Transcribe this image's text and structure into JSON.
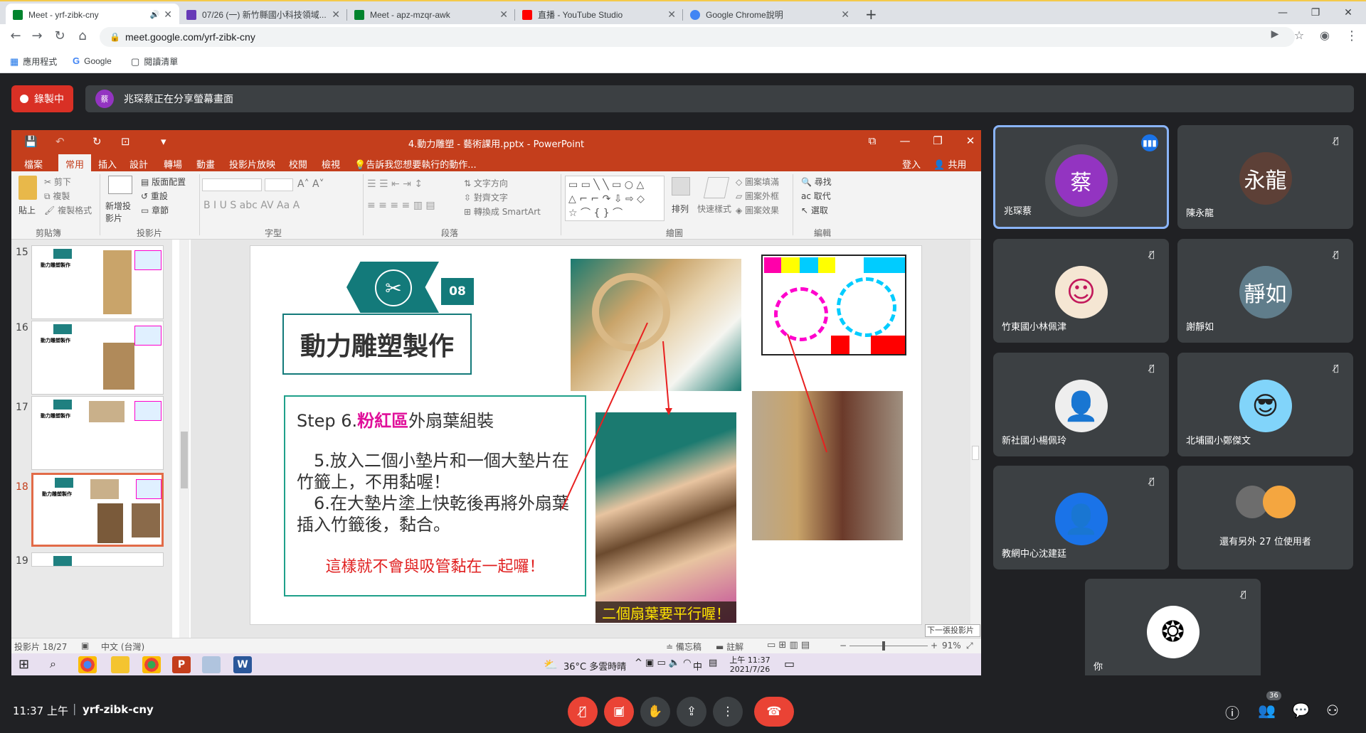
{
  "browser": {
    "tabs": [
      {
        "title": "Meet - yrf-zibk-cny",
        "icon_color": "#00832d"
      },
      {
        "title": "07/26 (一) 新竹縣國小科技領域...",
        "icon_color": "#673ab7"
      },
      {
        "title": "Meet - apz-mzqr-awk",
        "icon_color": "#00832d"
      },
      {
        "title": "直播 - YouTube Studio",
        "icon_color": "#ff0000"
      },
      {
        "title": "Google Chrome說明",
        "icon_color": "#4285f4"
      }
    ],
    "url": "meet.google.com/yrf-zibk-cny",
    "bookmarks": [
      "應用程式",
      "Google",
      "閱讀清單"
    ]
  },
  "meet": {
    "recording_label": "錄製中",
    "presenter_initial": "蔡",
    "share_notice": "兆琛蔡正在分享螢幕畫面",
    "clock": "11:37 上午",
    "meeting_code": "yrf-zibk-cny",
    "participant_count": "36",
    "participants": [
      {
        "name": "兆琛蔡",
        "initial": "蔡",
        "color": "#9334c1"
      },
      {
        "name": "陳永龍",
        "initial": "永龍",
        "color": "#5d4037"
      },
      {
        "name": "竹東國小林佩津",
        "initial": "",
        "color": "#f5e6d3"
      },
      {
        "name": "謝靜如",
        "initial": "靜如",
        "color": "#607d8b"
      },
      {
        "name": "新社國小楊佩玲",
        "initial": "",
        "color": "#eeeeee"
      },
      {
        "name": "北埔國小鄭傑文",
        "initial": "",
        "color": "#81d4fa"
      },
      {
        "name": "教網中心沈建廷",
        "initial": "",
        "color": "#1a73e8"
      },
      {
        "name": "還有另外 27 位使用者",
        "initial": "",
        "color": "#5f6368"
      },
      {
        "name": "你",
        "initial": "",
        "color": "#ffffff"
      }
    ]
  },
  "ppt": {
    "title": "4.動力雕塑 - 藝術課用.pptx - PowerPoint",
    "tabs": [
      "檔案",
      "常用",
      "插入",
      "設計",
      "轉場",
      "動畫",
      "投影片放映",
      "校閱",
      "檢視"
    ],
    "tell_me": "告訴我您想要執行的動作...",
    "signin": "登入",
    "share": "共用",
    "groups": [
      "剪貼簿",
      "投影片",
      "字型",
      "段落",
      "繪圖",
      "編輯"
    ],
    "ribbon_items": {
      "paste": "貼上",
      "cut": "剪下",
      "copy": "複製",
      "format_painter": "複製格式",
      "new_slide": "新增投影片",
      "layout": "版面配置",
      "reset": "重設",
      "section": "章節",
      "text_direction": "文字方向",
      "align_text": "對齊文字",
      "smartart": "轉換成 SmartArt",
      "arrange": "排列",
      "quick_styles": "快速樣式",
      "fill": "圖案填滿",
      "outline": "圖案外框",
      "effects": "圖案效果",
      "find": "尋找",
      "replace": "取代",
      "select": "選取"
    },
    "thumb_numbers": [
      "15",
      "16",
      "17",
      "18",
      "19"
    ],
    "thumb_title": "動力雕塑製作",
    "slide": {
      "badge_num": "08",
      "heading": "動力雕塑製作",
      "step_prefix": "Step 6.",
      "step_highlight": "粉紅區",
      "step_suffix": "外扇葉組裝",
      "line1": "5.放入二個小墊片和一個大墊片在竹籤上，不用黏喔！",
      "line2": "6.在大墊片塗上快乾後再將外扇葉插入竹籤後，黏合。",
      "warning": "這樣就不會與吸管黏在一起囉！",
      "caption": "二個扇葉要平行喔！"
    },
    "status": {
      "slide_pos": "投影片 18/27",
      "language": "中文 (台灣)",
      "notes": "備忘稿",
      "comments": "註解",
      "zoom": "91%",
      "tooltip": "下一張投影片"
    },
    "taskbar": {
      "weather": "36°C 多雲時晴",
      "ime": "中",
      "time": "上午 11:37",
      "date": "2021/7/26"
    }
  }
}
